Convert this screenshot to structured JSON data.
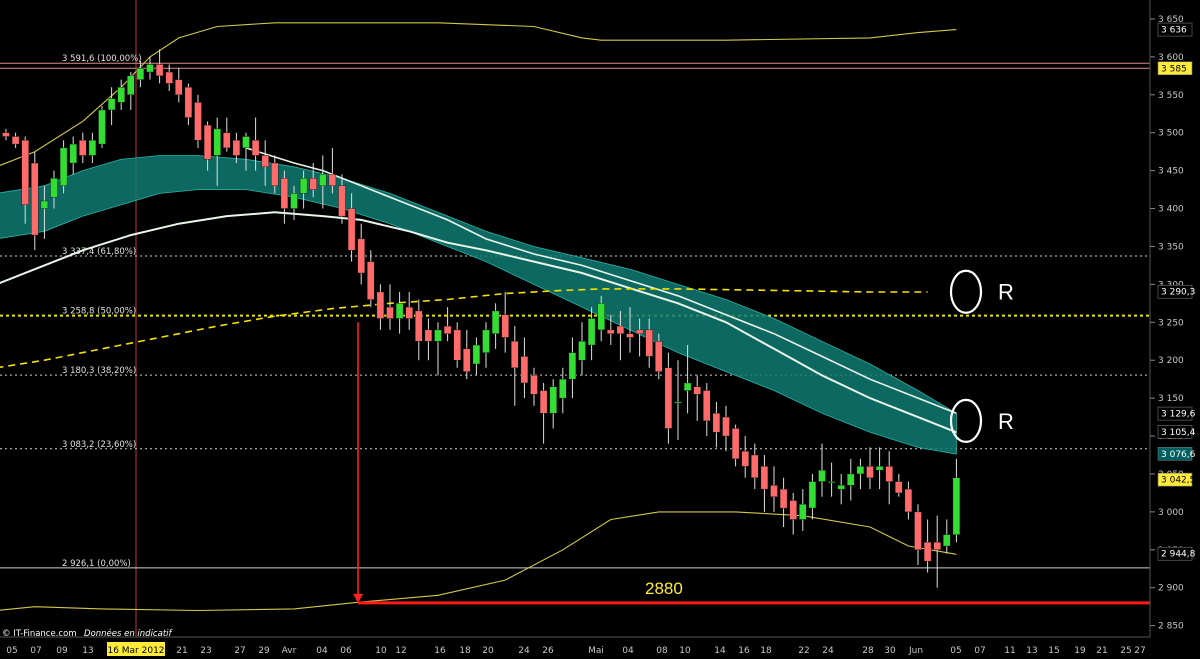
{
  "chart_data": {
    "type": "candlestick",
    "y_range": [
      2835,
      3675
    ],
    "y_ticks": [
      "3 650",
      "3 600",
      "3 550",
      "3 500",
      "3 450",
      "3 400",
      "3 350",
      "3 300",
      "3 250",
      "3 200",
      "3 150",
      "3 100",
      "3 050",
      "3 000",
      "2 950",
      "2 900",
      "2 850"
    ],
    "y_tick_values": [
      3650,
      3600,
      3550,
      3500,
      3450,
      3400,
      3350,
      3300,
      3250,
      3200,
      3150,
      3100,
      3050,
      3000,
      2950,
      2900,
      2850
    ],
    "x_labels": [
      "05",
      "07",
      "09",
      "13",
      "16 Mar 2012",
      "21",
      "23",
      "27",
      "29",
      "Avr",
      "04",
      "06",
      "10",
      "12",
      "16",
      "18",
      "20",
      "24",
      "26",
      "Mai",
      "04",
      "08",
      "10",
      "14",
      "16",
      "18",
      "22",
      "24",
      "28",
      "30",
      "Jun",
      "05",
      "07",
      "11",
      "13",
      "15",
      "19",
      "21",
      "25",
      "27"
    ],
    "highlight_x_label": "16 Mar 2012",
    "fib_levels": [
      {
        "label": "3 591,6 (100,00%)",
        "value": 3591.6
      },
      {
        "label": "3 337,4 (61,80%)",
        "value": 3337.4
      },
      {
        "label": "3 258,8 (50,00%)",
        "value": 3258.8
      },
      {
        "label": "3 180,3 (38,20%)",
        "value": 3180.3
      },
      {
        "label": "3 083,2 (23,60%)",
        "value": 3083.2
      },
      {
        "label": "2 926,1 (0,00%)",
        "value": 2926.1
      }
    ],
    "price_tags": [
      {
        "text": "3 636",
        "value": 3636,
        "bg": "#000000",
        "fg": "#ffffff"
      },
      {
        "text": "3 585",
        "value": 3585,
        "bg": "#ffeb3b",
        "fg": "#000000"
      },
      {
        "text": "3 290,3",
        "value": 3290.3,
        "bg": "#000000",
        "fg": "#ffffff"
      },
      {
        "text": "3 129,6",
        "value": 3129.6,
        "bg": "#000000",
        "fg": "#ffffff"
      },
      {
        "text": "3 105,4",
        "value": 3105.4,
        "bg": "#000000",
        "fg": "#ffffff"
      },
      {
        "text": "3 076,6",
        "value": 3076.6,
        "bg": "#006060",
        "fg": "#ffffff"
      },
      {
        "text": "3 042,5",
        "value": 3042.5,
        "bg": "#ffeb3b",
        "fg": "#000000"
      },
      {
        "text": "2 944,8",
        "value": 2944.8,
        "bg": "#000000",
        "fg": "#ffffff"
      }
    ],
    "annotations": {
      "target_label": "2880",
      "target_value": 2880,
      "resistance_labels": [
        "R",
        "R"
      ],
      "resistance_values": [
        3290.3,
        3120
      ]
    },
    "candles": [
      {
        "o": 3500,
        "h": 3505,
        "l": 3490,
        "c": 3495
      },
      {
        "o": 3495,
        "h": 3500,
        "l": 3480,
        "c": 3485
      },
      {
        "o": 3490,
        "h": 3495,
        "l": 3380,
        "c": 3405
      },
      {
        "o": 3460,
        "h": 3475,
        "l": 3345,
        "c": 3365
      },
      {
        "o": 3400,
        "h": 3430,
        "l": 3360,
        "c": 3410
      },
      {
        "o": 3415,
        "h": 3450,
        "l": 3400,
        "c": 3440
      },
      {
        "o": 3430,
        "h": 3490,
        "l": 3420,
        "c": 3480
      },
      {
        "o": 3460,
        "h": 3495,
        "l": 3445,
        "c": 3485
      },
      {
        "o": 3490,
        "h": 3500,
        "l": 3460,
        "c": 3470
      },
      {
        "o": 3470,
        "h": 3500,
        "l": 3460,
        "c": 3490
      },
      {
        "o": 3485,
        "h": 3535,
        "l": 3480,
        "c": 3530
      },
      {
        "o": 3530,
        "h": 3560,
        "l": 3510,
        "c": 3545
      },
      {
        "o": 3540,
        "h": 3570,
        "l": 3530,
        "c": 3560
      },
      {
        "o": 3550,
        "h": 3580,
        "l": 3530,
        "c": 3575
      },
      {
        "o": 3570,
        "h": 3595,
        "l": 3560,
        "c": 3585
      },
      {
        "o": 3580,
        "h": 3600,
        "l": 3570,
        "c": 3590
      },
      {
        "o": 3590,
        "h": 3610,
        "l": 3565,
        "c": 3575
      },
      {
        "o": 3580,
        "h": 3590,
        "l": 3555,
        "c": 3565
      },
      {
        "o": 3570,
        "h": 3585,
        "l": 3540,
        "c": 3550
      },
      {
        "o": 3560,
        "h": 3565,
        "l": 3510,
        "c": 3520
      },
      {
        "o": 3540,
        "h": 3550,
        "l": 3480,
        "c": 3490
      },
      {
        "o": 3510,
        "h": 3515,
        "l": 3450,
        "c": 3465
      },
      {
        "o": 3470,
        "h": 3520,
        "l": 3430,
        "c": 3505
      },
      {
        "o": 3500,
        "h": 3520,
        "l": 3475,
        "c": 3480
      },
      {
        "o": 3490,
        "h": 3500,
        "l": 3460,
        "c": 3470
      },
      {
        "o": 3480,
        "h": 3500,
        "l": 3450,
        "c": 3495
      },
      {
        "o": 3490,
        "h": 3520,
        "l": 3450,
        "c": 3470
      },
      {
        "o": 3470,
        "h": 3490,
        "l": 3430,
        "c": 3455
      },
      {
        "o": 3460,
        "h": 3470,
        "l": 3420,
        "c": 3430
      },
      {
        "o": 3440,
        "h": 3450,
        "l": 3380,
        "c": 3400
      },
      {
        "o": 3400,
        "h": 3430,
        "l": 3385,
        "c": 3420
      },
      {
        "o": 3420,
        "h": 3450,
        "l": 3400,
        "c": 3440
      },
      {
        "o": 3440,
        "h": 3460,
        "l": 3415,
        "c": 3425
      },
      {
        "o": 3430,
        "h": 3470,
        "l": 3400,
        "c": 3445
      },
      {
        "o": 3445,
        "h": 3480,
        "l": 3420,
        "c": 3430
      },
      {
        "o": 3430,
        "h": 3445,
        "l": 3380,
        "c": 3390
      },
      {
        "o": 3400,
        "h": 3420,
        "l": 3330,
        "c": 3345
      },
      {
        "o": 3360,
        "h": 3380,
        "l": 3300,
        "c": 3315
      },
      {
        "o": 3330,
        "h": 3345,
        "l": 3270,
        "c": 3280
      },
      {
        "o": 3290,
        "h": 3300,
        "l": 3240,
        "c": 3255
      },
      {
        "o": 3270,
        "h": 3300,
        "l": 3240,
        "c": 3255
      },
      {
        "o": 3255,
        "h": 3290,
        "l": 3235,
        "c": 3275
      },
      {
        "o": 3270,
        "h": 3290,
        "l": 3240,
        "c": 3255
      },
      {
        "o": 3265,
        "h": 3280,
        "l": 3200,
        "c": 3225
      },
      {
        "o": 3240,
        "h": 3255,
        "l": 3200,
        "c": 3225
      },
      {
        "o": 3225,
        "h": 3250,
        "l": 3180,
        "c": 3240
      },
      {
        "o": 3245,
        "h": 3270,
        "l": 3225,
        "c": 3235
      },
      {
        "o": 3240,
        "h": 3250,
        "l": 3190,
        "c": 3200
      },
      {
        "o": 3215,
        "h": 3240,
        "l": 3175,
        "c": 3185
      },
      {
        "o": 3195,
        "h": 3230,
        "l": 3180,
        "c": 3220
      },
      {
        "o": 3210,
        "h": 3250,
        "l": 3190,
        "c": 3240
      },
      {
        "o": 3235,
        "h": 3275,
        "l": 3215,
        "c": 3265
      },
      {
        "o": 3260,
        "h": 3290,
        "l": 3210,
        "c": 3230
      },
      {
        "o": 3225,
        "h": 3245,
        "l": 3140,
        "c": 3190
      },
      {
        "o": 3205,
        "h": 3230,
        "l": 3150,
        "c": 3170
      },
      {
        "o": 3180,
        "h": 3190,
        "l": 3140,
        "c": 3155
      },
      {
        "o": 3160,
        "h": 3170,
        "l": 3090,
        "c": 3130
      },
      {
        "o": 3130,
        "h": 3175,
        "l": 3110,
        "c": 3165
      },
      {
        "o": 3150,
        "h": 3190,
        "l": 3130,
        "c": 3175
      },
      {
        "o": 3175,
        "h": 3230,
        "l": 3150,
        "c": 3210
      },
      {
        "o": 3200,
        "h": 3250,
        "l": 3180,
        "c": 3225
      },
      {
        "o": 3220,
        "h": 3270,
        "l": 3200,
        "c": 3255
      },
      {
        "o": 3240,
        "h": 3285,
        "l": 3225,
        "c": 3275
      },
      {
        "o": 3240,
        "h": 3260,
        "l": 3220,
        "c": 3235
      },
      {
        "o": 3245,
        "h": 3265,
        "l": 3200,
        "c": 3235
      },
      {
        "o": 3235,
        "h": 3270,
        "l": 3210,
        "c": 3230
      },
      {
        "o": 3240,
        "h": 3255,
        "l": 3205,
        "c": 3235
      },
      {
        "o": 3240,
        "h": 3255,
        "l": 3190,
        "c": 3205
      },
      {
        "o": 3225,
        "h": 3235,
        "l": 3175,
        "c": 3185
      },
      {
        "o": 3190,
        "h": 3210,
        "l": 3090,
        "c": 3110
      },
      {
        "o": 3145,
        "h": 3200,
        "l": 3095,
        "c": 3145
      },
      {
        "o": 3160,
        "h": 3220,
        "l": 3130,
        "c": 3170
      },
      {
        "o": 3165,
        "h": 3180,
        "l": 3120,
        "c": 3155
      },
      {
        "o": 3160,
        "h": 3170,
        "l": 3100,
        "c": 3120
      },
      {
        "o": 3130,
        "h": 3145,
        "l": 3085,
        "c": 3105
      },
      {
        "o": 3125,
        "h": 3140,
        "l": 3080,
        "c": 3100
      },
      {
        "o": 3110,
        "h": 3115,
        "l": 3060,
        "c": 3070
      },
      {
        "o": 3080,
        "h": 3100,
        "l": 3045,
        "c": 3060
      },
      {
        "o": 3075,
        "h": 3090,
        "l": 3030,
        "c": 3045
      },
      {
        "o": 3060,
        "h": 3075,
        "l": 3000,
        "c": 3030
      },
      {
        "o": 3035,
        "h": 3060,
        "l": 3000,
        "c": 3020
      },
      {
        "o": 3030,
        "h": 3045,
        "l": 2980,
        "c": 3005
      },
      {
        "o": 3015,
        "h": 3025,
        "l": 2970,
        "c": 2990
      },
      {
        "o": 2990,
        "h": 3030,
        "l": 2975,
        "c": 3010
      },
      {
        "o": 3005,
        "h": 3050,
        "l": 2990,
        "c": 3040
      },
      {
        "o": 3040,
        "h": 3090,
        "l": 3020,
        "c": 3055
      },
      {
        "o": 3040,
        "h": 3065,
        "l": 3020,
        "c": 3040
      },
      {
        "o": 3030,
        "h": 3050,
        "l": 3010,
        "c": 3035
      },
      {
        "o": 3035,
        "h": 3070,
        "l": 3015,
        "c": 3050
      },
      {
        "o": 3050,
        "h": 3070,
        "l": 3030,
        "c": 3060
      },
      {
        "o": 3060,
        "h": 3085,
        "l": 3030,
        "c": 3045
      },
      {
        "o": 3055,
        "h": 3085,
        "l": 3030,
        "c": 3060
      },
      {
        "o": 3060,
        "h": 3080,
        "l": 3010,
        "c": 3040
      },
      {
        "o": 3040,
        "h": 3050,
        "l": 3020,
        "c": 3025
      },
      {
        "o": 3030,
        "h": 3040,
        "l": 2990,
        "c": 3000
      },
      {
        "o": 3000,
        "h": 3010,
        "l": 2930,
        "c": 2950
      },
      {
        "o": 2960,
        "h": 2990,
        "l": 2920,
        "c": 2935
      },
      {
        "o": 2960,
        "h": 2995,
        "l": 2900,
        "c": 2950
      },
      {
        "o": 2955,
        "h": 2990,
        "l": 2945,
        "c": 2970
      },
      {
        "o": 2970,
        "h": 3070,
        "l": 2960,
        "c": 3045
      }
    ]
  },
  "credit": {
    "source": "© IT-Finance.com",
    "note": "Données en indicatif"
  }
}
